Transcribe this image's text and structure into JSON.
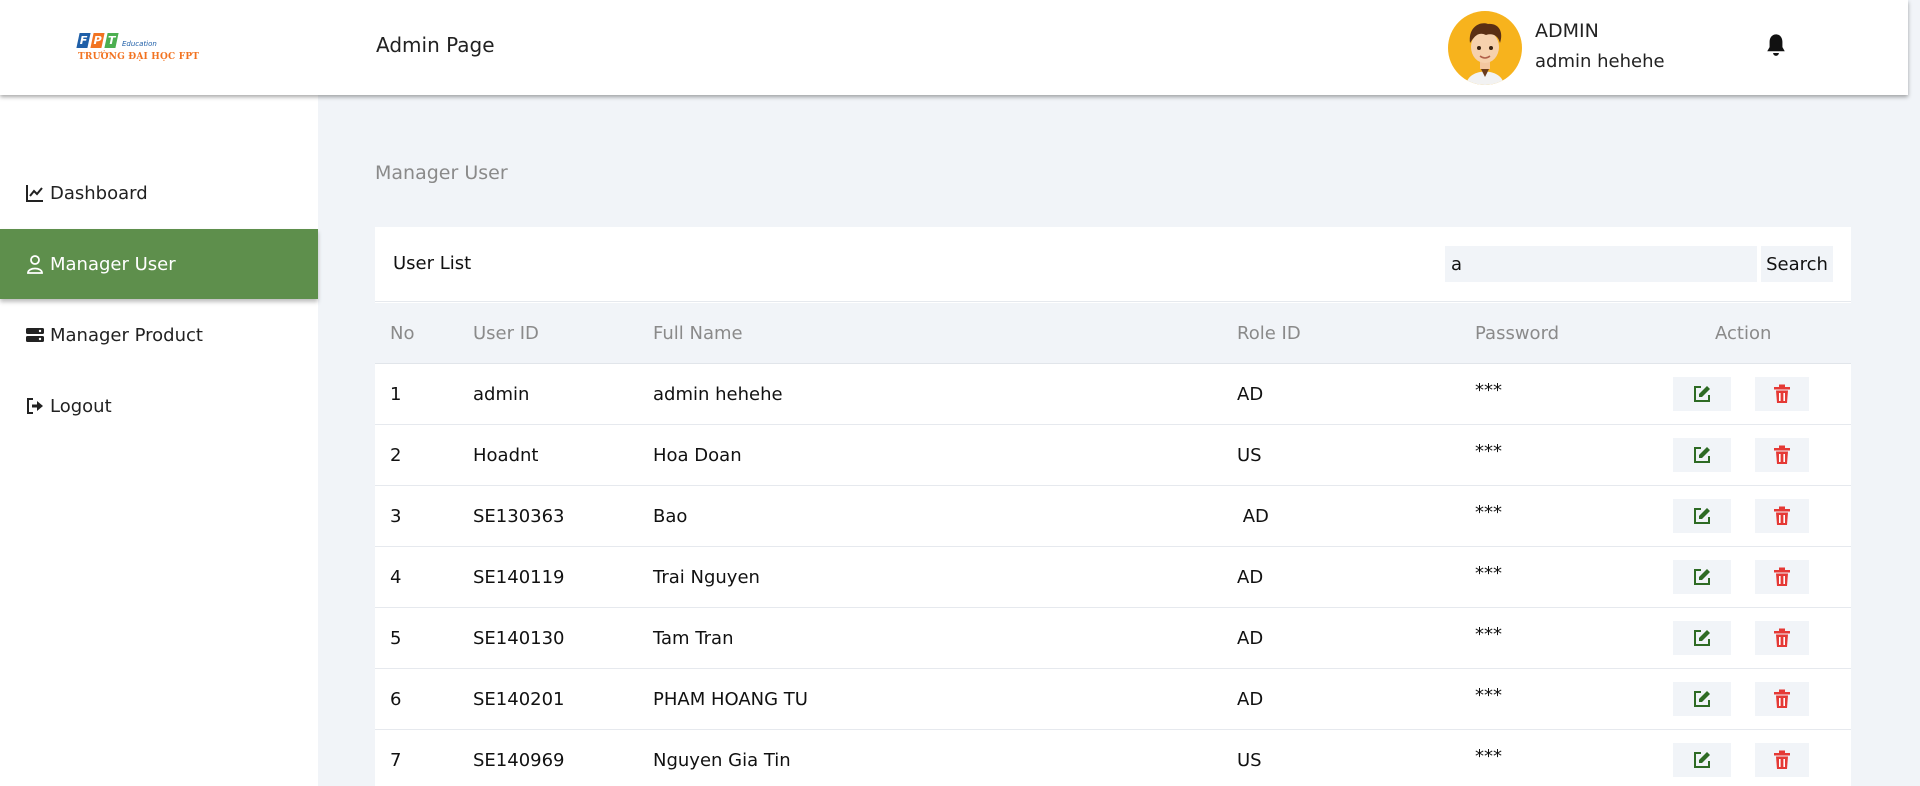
{
  "brand": {
    "logo_letters": [
      "F",
      "P",
      "T"
    ],
    "logo_colors": [
      "#1f5fa8",
      "#f27321",
      "#4caf50"
    ],
    "logo_sub": "Education",
    "logo_school": "TRƯỜNG ĐẠI HỌC FPT"
  },
  "header": {
    "title": "Admin Page",
    "user_role": "ADMIN",
    "user_name": "admin hehehe",
    "bell_icon": "bell-icon"
  },
  "sidebar": {
    "items": [
      {
        "label": "Dashboard",
        "icon": "line-chart-icon",
        "active": false
      },
      {
        "label": "Manager User",
        "icon": "user-icon",
        "active": true
      },
      {
        "label": "Manager Product",
        "icon": "server-icon",
        "active": false
      },
      {
        "label": "Logout",
        "icon": "sign-out-icon",
        "active": false
      }
    ]
  },
  "main": {
    "section_title": "Manager User",
    "card_title": "User List",
    "search_value": "a",
    "search_button": "Search",
    "columns": [
      "No",
      "User ID",
      "Full Name",
      "Role ID",
      "Password",
      "Action"
    ],
    "rows": [
      {
        "no": "1",
        "user_id": "admin",
        "full_name": "admin hehehe",
        "role_id": "AD",
        "password": "***"
      },
      {
        "no": "2",
        "user_id": "Hoadnt",
        "full_name": "Hoa Doan",
        "role_id": "US",
        "password": "***"
      },
      {
        "no": "3",
        "user_id": "SE130363",
        "full_name": "Bao",
        "role_id": " AD",
        "password": "***"
      },
      {
        "no": "4",
        "user_id": "SE140119",
        "full_name": "Trai Nguyen",
        "role_id": "AD",
        "password": "***"
      },
      {
        "no": "5",
        "user_id": "SE140130",
        "full_name": "Tam Tran",
        "role_id": "AD",
        "password": "***"
      },
      {
        "no": "6",
        "user_id": "SE140201",
        "full_name": "PHAM HOANG TU",
        "role_id": "AD",
        "password": "***"
      },
      {
        "no": "7",
        "user_id": "SE140969",
        "full_name": "Nguyen Gia Tin",
        "role_id": "US",
        "password": "***"
      }
    ],
    "action_icons": {
      "edit": "edit-icon",
      "delete": "trash-icon"
    },
    "colors": {
      "edit": "#2e6b24",
      "delete": "#e53935",
      "active_nav": "#5e8f4c"
    }
  }
}
